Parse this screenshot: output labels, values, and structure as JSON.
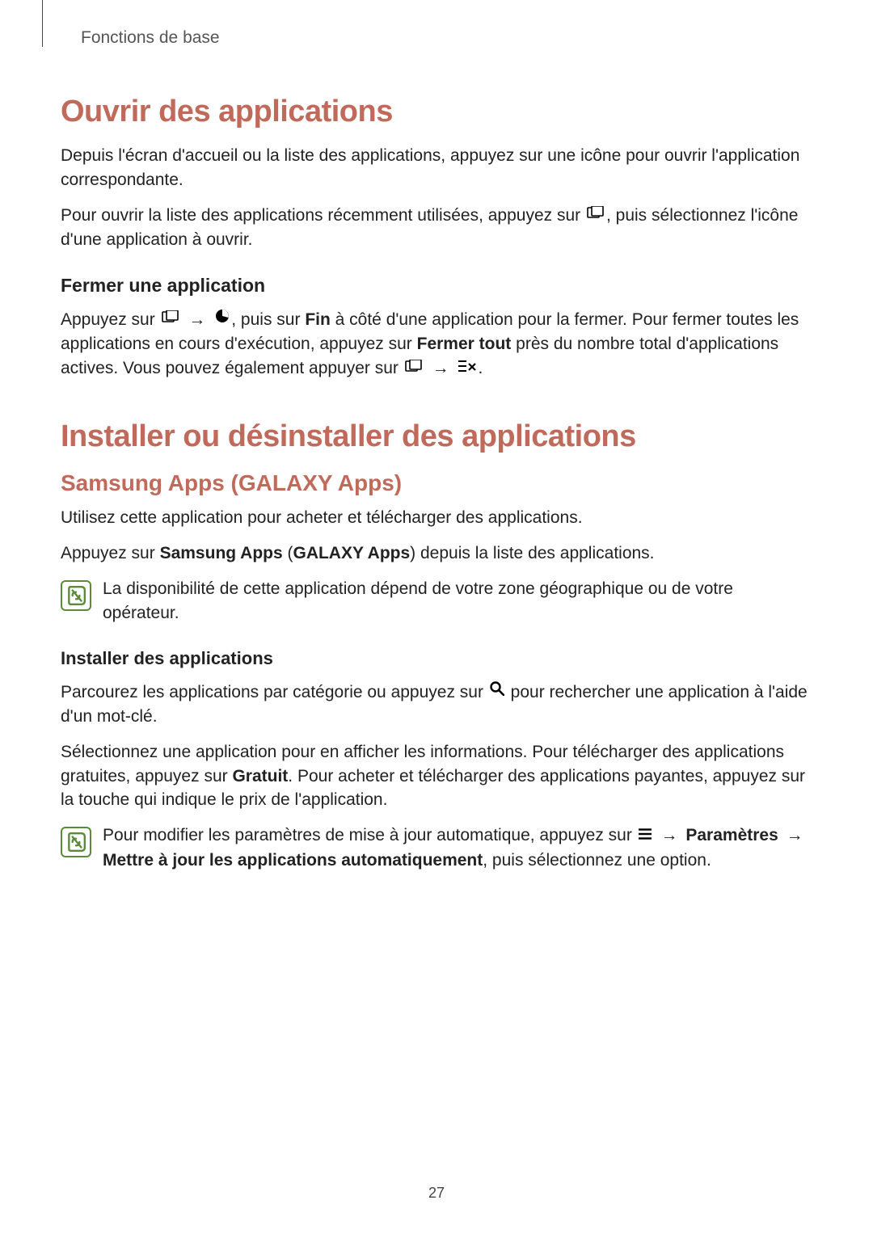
{
  "header": {
    "section_title": "Fonctions de base"
  },
  "section1": {
    "heading": "Ouvrir des applications",
    "p1": "Depuis l'écran d'accueil ou la liste des applications, appuyez sur une icône pour ouvrir l'application correspondante.",
    "p2a": "Pour ouvrir la liste des applications récemment utilisées, appuyez sur ",
    "p2b": ", puis sélectionnez l'icône d'une application à ouvrir.",
    "sub1_heading": "Fermer une application",
    "sub1_p1a": "Appuyez sur ",
    "sub1_p1b": ", puis sur ",
    "sub1_p1_bold1": "Fin",
    "sub1_p1c": " à côté d'une application pour la fermer. Pour fermer toutes les applications en cours d'exécution, appuyez sur ",
    "sub1_p1_bold2": "Fermer tout",
    "sub1_p1d": " près du nombre total d'applications actives. Vous pouvez également appuyer sur ",
    "sub1_p1e": "."
  },
  "section2": {
    "heading": "Installer ou désinstaller des applications",
    "sub1_heading": "Samsung Apps (GALAXY Apps)",
    "p1": "Utilisez cette application pour acheter et télécharger des applications.",
    "p2a": "Appuyez sur ",
    "p2_bold1": "Samsung Apps",
    "p2b": " (",
    "p2_bold2": "GALAXY Apps",
    "p2c": ") depuis la liste des applications.",
    "note1": "La disponibilité de cette application dépend de votre zone géographique ou de votre opérateur.",
    "sub2_heading": "Installer des applications",
    "p3a": "Parcourez les applications par catégorie ou appuyez sur ",
    "p3b": " pour rechercher une application à l'aide d'un mot-clé.",
    "p4a": "Sélectionnez une application pour en afficher les informations. Pour télécharger des applications gratuites, appuyez sur ",
    "p4_bold1": "Gratuit",
    "p4b": ". Pour acheter et télécharger des applications payantes, appuyez sur la touche qui indique le prix de l'application.",
    "note2a": "Pour modifier les paramètres de mise à jour automatique, appuyez sur ",
    "note2_bold1": "Paramètres",
    "note2_bold2": "Mettre à jour les applications automatiquement",
    "note2b": ", puis sélectionnez une option."
  },
  "arrow": "→",
  "page_number": "27"
}
